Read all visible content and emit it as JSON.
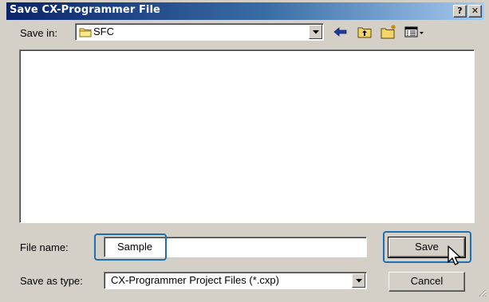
{
  "window": {
    "title": "Save CX-Programmer File",
    "help_button": "?",
    "close_button": "✕"
  },
  "toolbar": {
    "save_in_label": "Save in:",
    "current_folder": "SFC",
    "icons": [
      "back-arrow-icon",
      "up-one-level-icon",
      "new-folder-icon",
      "view-menu-icon"
    ]
  },
  "file_list": {
    "items": []
  },
  "form": {
    "file_name_label": "File name:",
    "file_name_value": "Sample",
    "save_as_type_label": "Save as type:",
    "save_as_type_value": "CX-Programmer Project Files (*.cxp)"
  },
  "buttons": {
    "save_label": "Save",
    "cancel_label": "Cancel"
  },
  "colors": {
    "title_bar_start": "#0a246a",
    "title_bar_end": "#a6caf0",
    "dialog_face": "#d4d0c8",
    "callout_highlight": "#1b6fb5"
  }
}
